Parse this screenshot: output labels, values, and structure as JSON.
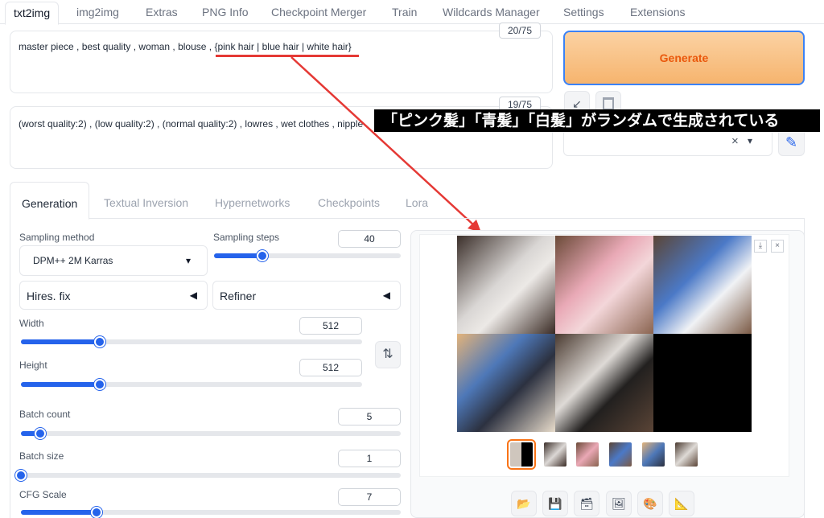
{
  "top_tabs": [
    "txt2img",
    "img2img",
    "Extras",
    "PNG Info",
    "Checkpoint Merger",
    "Train",
    "Wildcards Manager",
    "Settings",
    "Extensions"
  ],
  "prompt": {
    "text_plain": "master piece , best quality , woman , blouse , ",
    "text_wildcard": "{pink hair | blue hair | white hair}",
    "counter": "20/75"
  },
  "negative_prompt": {
    "text": "(worst quality:2) , (low quality:2) , (normal quality:2) , lowres , wet clothes , nipple",
    "counter": "19/75"
  },
  "overlay_banner": "「ピンク髪」「青髪」「白髪」がランダムで生成されている",
  "generate_label": "Generate",
  "sub_tabs": [
    "Generation",
    "Textual Inversion",
    "Hypernetworks",
    "Checkpoints",
    "Lora"
  ],
  "params": {
    "sampling_method_label": "Sampling method",
    "sampling_method_value": "DPM++ 2M Karras",
    "sampling_steps_label": "Sampling steps",
    "sampling_steps_value": "40",
    "hires_label": "Hires. fix",
    "refiner_label": "Refiner",
    "width_label": "Width",
    "width_value": "512",
    "height_label": "Height",
    "height_value": "512",
    "batch_count_label": "Batch count",
    "batch_count_value": "5",
    "batch_size_label": "Batch size",
    "batch_size_value": "1",
    "cfg_label": "CFG Scale",
    "cfg_value": "7"
  },
  "slider_fractions": {
    "sampling_steps": 0.26,
    "width": 0.23,
    "height": 0.23,
    "batch_count": 0.05,
    "batch_size": 0.0,
    "cfg": 0.2
  },
  "icons": {
    "arrow_to_prompt": "↙",
    "trash": "🗑",
    "clear": "×",
    "caret": "▾",
    "pencil": "✎",
    "accordion_arrow": "◀",
    "swap": "⇅",
    "download": "⤓",
    "close": "×",
    "folder": "📂",
    "save": "💾",
    "zip": "🗃",
    "image": "🖼",
    "palette": "🎨",
    "ruler": "📐"
  },
  "colors": {
    "accent": "#2563eb",
    "generate_text": "#ea580c",
    "annotation_red": "#e53935"
  }
}
